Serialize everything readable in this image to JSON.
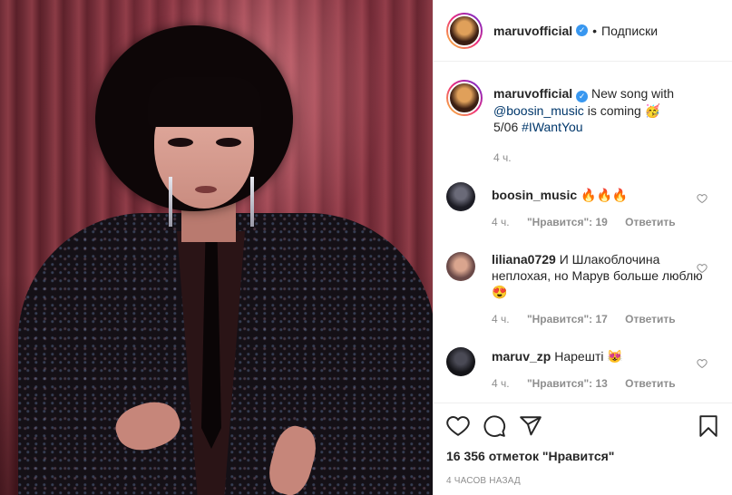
{
  "header": {
    "username": "maruvofficial",
    "follow_label": "Подписки",
    "separator": "•"
  },
  "caption": {
    "username": "maruvofficial",
    "text_part1": "New song with",
    "mention": "@boosin_music",
    "text_part2": "is coming",
    "emoji": "🥳",
    "date": "5/06",
    "hashtag": "#IWantYou",
    "time_ago": "4 ч."
  },
  "comments": [
    {
      "username": "boosin_music",
      "text": "🔥🔥🔥",
      "time_ago": "4 ч.",
      "likes_label": "\"Нравится\": 19",
      "reply_label": "Ответить"
    },
    {
      "username": "liliana0729",
      "text": "И Шлакоблочина неплохая, но Марув больше люблю 😍",
      "time_ago": "4 ч.",
      "likes_label": "\"Нравится\": 17",
      "reply_label": "Ответить"
    },
    {
      "username": "maruv_zp",
      "text": "Нарешті 😻",
      "time_ago": "4 ч.",
      "likes_label": "\"Нравится\": 13",
      "reply_label": "Ответить"
    }
  ],
  "footer": {
    "likes_text": "16 356 отметок \"Нравится\"",
    "timestamp": "4 часов назад"
  },
  "icons": {
    "like": "heart-icon",
    "comment": "comment-bubble-icon",
    "share": "paper-plane-icon",
    "save": "bookmark-icon",
    "verified": "verified-badge-icon"
  },
  "colors": {
    "verified_blue": "#3897f0",
    "text": "#262626",
    "muted": "#8e8e8e",
    "link": "#00376b"
  }
}
